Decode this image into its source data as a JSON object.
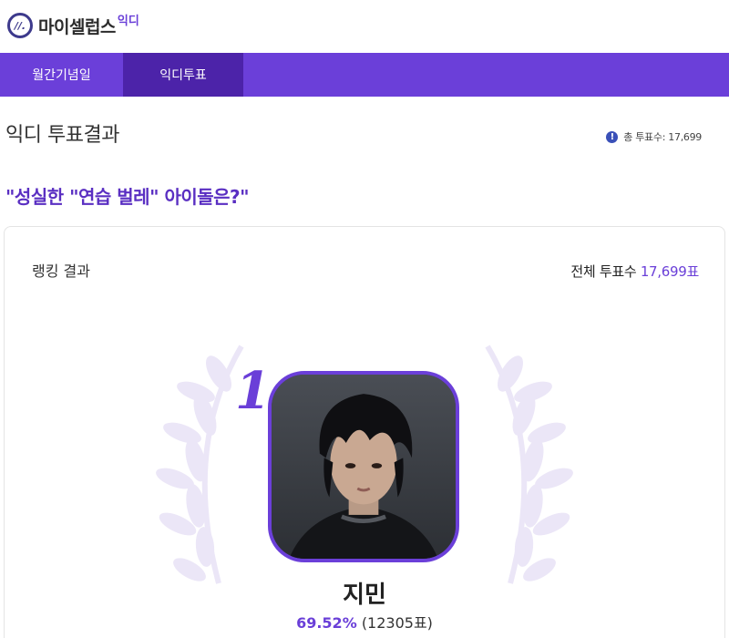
{
  "brand": {
    "logo_mark": "//.",
    "name": "마이셀럽스",
    "sub": "익디"
  },
  "nav": {
    "tabs": [
      {
        "label": "월간기념일"
      },
      {
        "label": "익디투표"
      }
    ]
  },
  "page": {
    "title": "익디 투표결과",
    "total_small": "총 투표수: 17,699"
  },
  "poll": {
    "question": "\"성실한 \"연습 벌레\" 아이돌은?\"",
    "ranking_label": "랭킹 결과",
    "total_label": "전체 투표수",
    "total_value": "17,699표"
  },
  "winner": {
    "rank": "1",
    "name": "지민",
    "percent": "69.52%",
    "votes": "(12305표)"
  },
  "colors": {
    "accent": "#6b3fd9",
    "accent_dark": "#4c23a9",
    "laurel": "#ebe6f7"
  }
}
